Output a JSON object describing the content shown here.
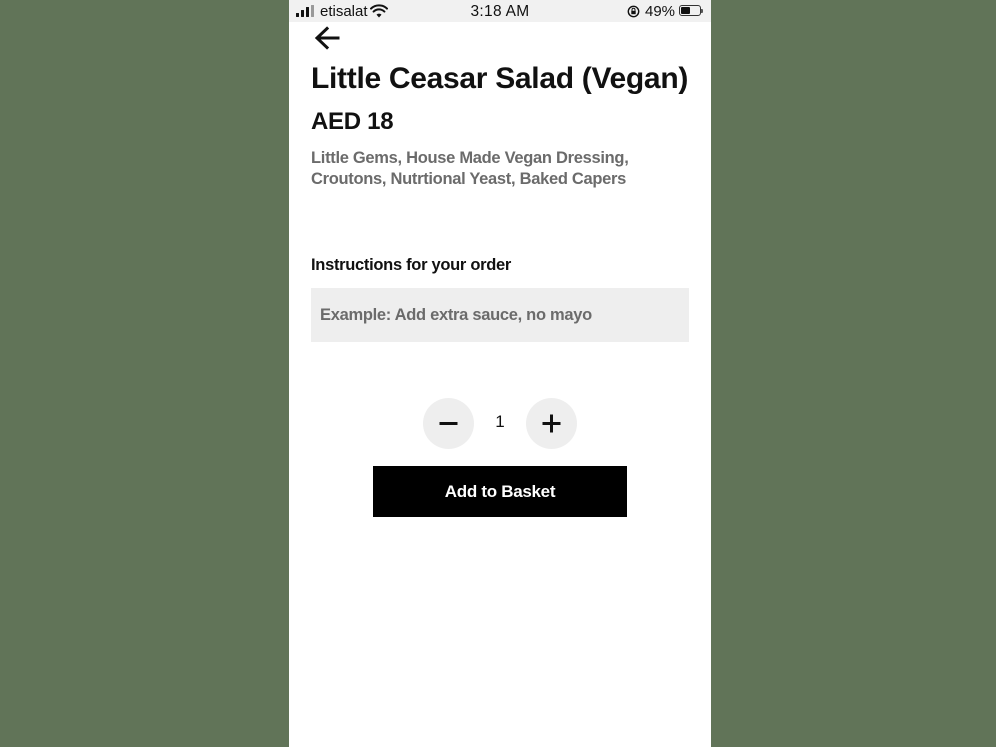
{
  "status_bar": {
    "carrier": "etisalat",
    "time": "3:18 AM",
    "battery_percent": "49%",
    "battery_level": 0.49,
    "icons": [
      "signal-icon",
      "wifi-icon",
      "rotation-lock-icon",
      "battery-icon"
    ]
  },
  "nav": {
    "back_icon": "arrow-left-icon"
  },
  "item": {
    "name": "Little Ceasar Salad (Vegan)",
    "price": "AED 18",
    "description": "Little Gems, House Made Vegan Dressing, Croutons, Nutrtional Yeast, Baked Capers"
  },
  "instructions": {
    "label": "Instructions for your order",
    "placeholder": "Example: Add extra sauce, no mayo",
    "value": ""
  },
  "quantity": {
    "value": "1",
    "decrease_icon": "minus-icon",
    "increase_icon": "plus-icon"
  },
  "actions": {
    "add_to_basket_label": "Add to Basket"
  },
  "colors": {
    "background": "#617458",
    "surface": "#ffffff",
    "input_bg": "#eeeeee",
    "primary_button": "#000000",
    "muted_text": "#6b6b6b"
  }
}
